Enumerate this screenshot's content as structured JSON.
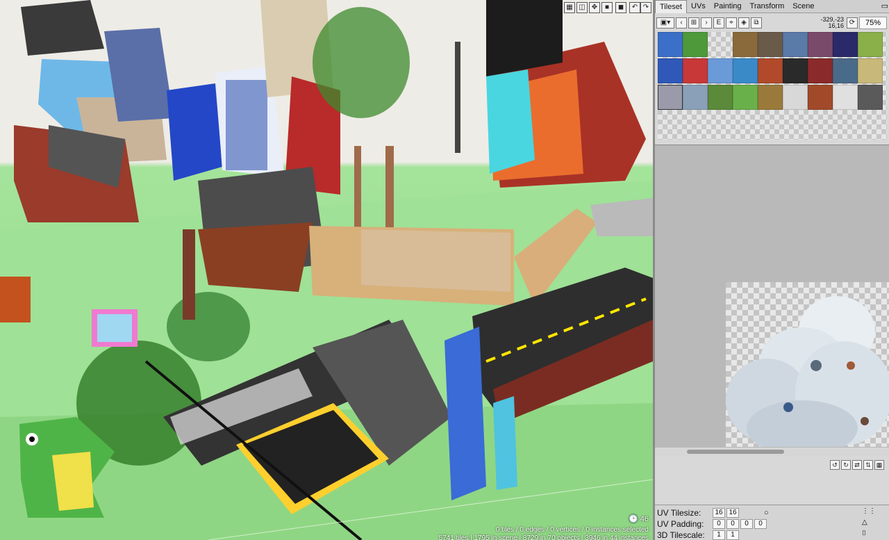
{
  "toolbar_viewport": {
    "icons": [
      "grid-icon",
      "camera-icon",
      "move-icon",
      "cube-icon",
      "undo-icon",
      "redo-icon"
    ]
  },
  "viewport": {
    "status_line1": "0 tiles / 0 edges / 0 vertices / 0 instances selected",
    "status_line2": "5741 tiles | 1795 in scene | 8729 in 70 objects | 3946 in 44 instances",
    "fps": "46"
  },
  "panel": {
    "tabs": [
      {
        "label": "Tileset",
        "active": true
      },
      {
        "label": "UVs"
      },
      {
        "label": "Painting"
      },
      {
        "label": "Transform"
      },
      {
        "label": "Scene"
      }
    ],
    "coords_line1": "-329,-23",
    "coords_line2": "16,16",
    "zoom": "75%",
    "uv_tilesize_label": "UV Tilesize:",
    "uv_tilesize": [
      "16",
      "16"
    ],
    "uv_padding_label": "UV Padding:",
    "uv_padding": [
      "0",
      "0",
      "0",
      "0"
    ],
    "tilescale_label": "3D Tilescale:",
    "tilescale": [
      "1",
      "1"
    ]
  },
  "colors": {
    "sky": "#eeece6",
    "ground": "#98dd8e",
    "panel_bg": "#d8d8d8",
    "accent_yellow": "#ffe600"
  }
}
